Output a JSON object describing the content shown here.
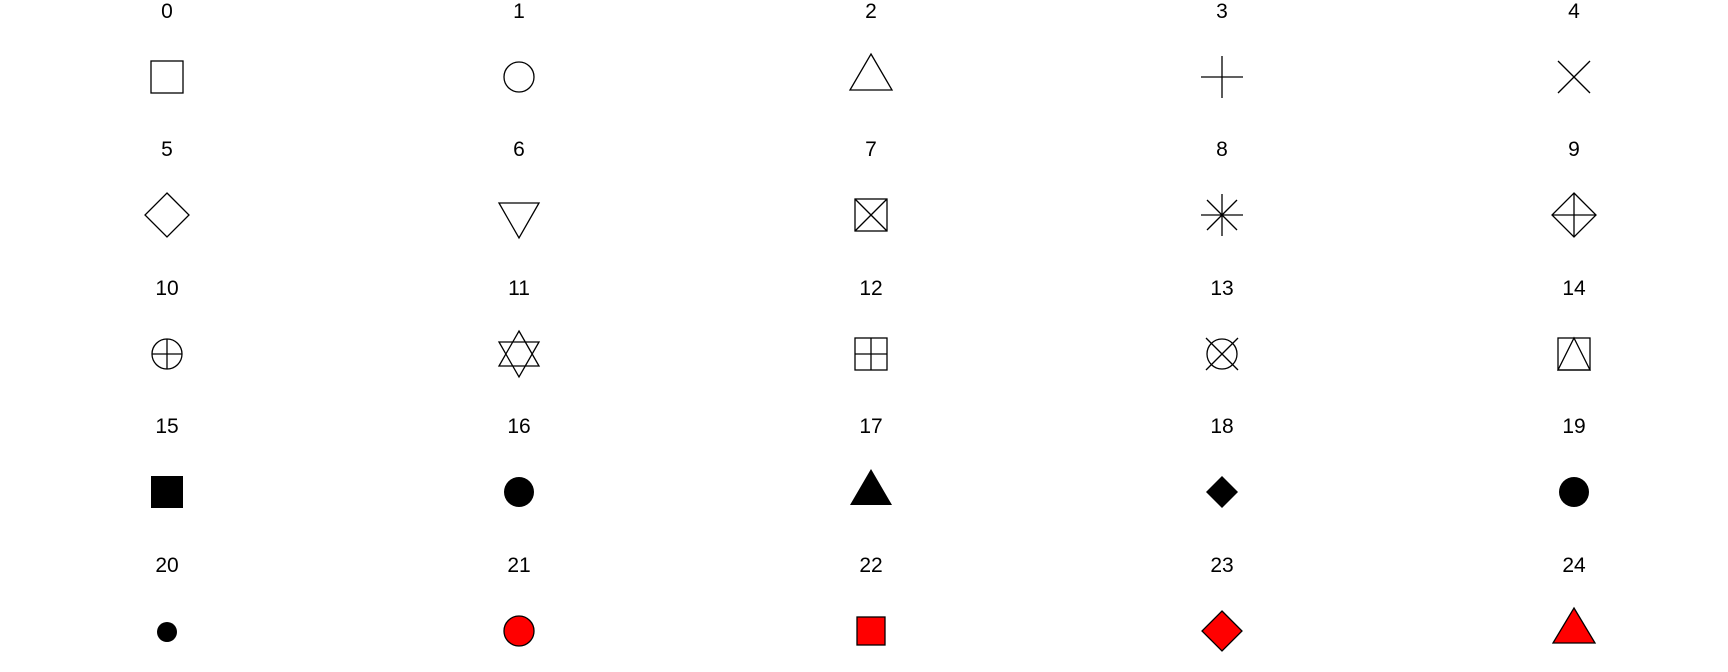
{
  "symbols": [
    {
      "label": "0",
      "shape": "open-square"
    },
    {
      "label": "1",
      "shape": "open-circle"
    },
    {
      "label": "2",
      "shape": "open-triangle-up"
    },
    {
      "label": "3",
      "shape": "plus"
    },
    {
      "label": "4",
      "shape": "cross"
    },
    {
      "label": "5",
      "shape": "open-diamond"
    },
    {
      "label": "6",
      "shape": "open-triangle-down"
    },
    {
      "label": "7",
      "shape": "square-cross"
    },
    {
      "label": "8",
      "shape": "asterisk"
    },
    {
      "label": "9",
      "shape": "diamond-plus"
    },
    {
      "label": "10",
      "shape": "circle-plus"
    },
    {
      "label": "11",
      "shape": "triangles-up-down"
    },
    {
      "label": "12",
      "shape": "square-plus"
    },
    {
      "label": "13",
      "shape": "circle-cross"
    },
    {
      "label": "14",
      "shape": "square-triangle"
    },
    {
      "label": "15",
      "shape": "filled-square"
    },
    {
      "label": "16",
      "shape": "filled-circle"
    },
    {
      "label": "17",
      "shape": "filled-triangle-up"
    },
    {
      "label": "18",
      "shape": "filled-diamond-small"
    },
    {
      "label": "19",
      "shape": "solid-circle"
    },
    {
      "label": "20",
      "shape": "small-filled-circle"
    },
    {
      "label": "21",
      "shape": "filled-circle-red"
    },
    {
      "label": "22",
      "shape": "filled-square-red"
    },
    {
      "label": "23",
      "shape": "filled-diamond-red"
    },
    {
      "label": "24",
      "shape": "filled-triangle-red"
    }
  ],
  "colors": {
    "stroke": "#000000",
    "fill_black": "#000000",
    "fill_red": "#ff0000"
  }
}
